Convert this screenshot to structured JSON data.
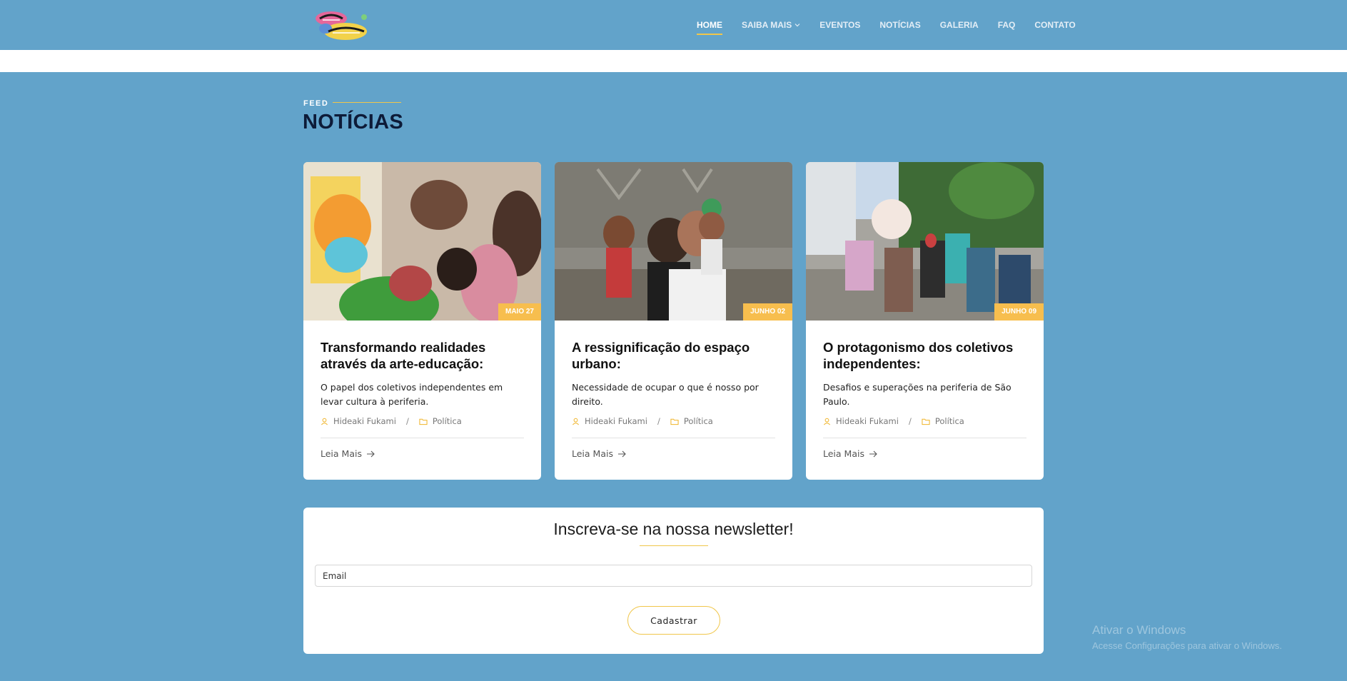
{
  "header": {
    "logo_alt": "Amigos do Bairro",
    "nav": [
      {
        "label": "HOME",
        "active": true
      },
      {
        "label": "SAIBA MAIS",
        "has_dropdown": true
      },
      {
        "label": "EVENTOS"
      },
      {
        "label": "NOTÍCIAS"
      },
      {
        "label": "GALERIA"
      },
      {
        "label": "FAQ"
      },
      {
        "label": "CONTATO"
      }
    ]
  },
  "section": {
    "eyebrow": "FEED",
    "title": "NOTÍCIAS"
  },
  "cards": [
    {
      "date": "MAIO 27",
      "title": "Transformando realidades através da arte-educação:",
      "description": "O papel dos coletivos independentes em levar cultura à periferia.",
      "author": "Hideaki Fukami",
      "category": "Política",
      "read_more": "Leia Mais"
    },
    {
      "date": "JUNHO 02",
      "title": "A ressignificação do espaço urbano:",
      "description": "Necessidade de ocupar o que é nosso por direito.",
      "author": "Hideaki Fukami",
      "category": "Política",
      "read_more": "Leia Mais"
    },
    {
      "date": "JUNHO 09",
      "title": "O protagonismo dos coletivos independentes:",
      "description": "Desafios e superações na periferia de São Paulo.",
      "author": "Hideaki Fukami",
      "category": "Política",
      "read_more": "Leia Mais"
    }
  ],
  "newsletter": {
    "title": "Inscreva-se na nossa newsletter!",
    "email_placeholder": "Email",
    "button_label": "Cadastrar"
  },
  "watermark": {
    "title": "Ativar o Windows",
    "subtitle": "Acesse Configurações para ativar o Windows."
  },
  "colors": {
    "background": "#62a3ca",
    "accent": "#f0c64a",
    "badge": "#f7be4e",
    "title_dark": "#0d1b38"
  },
  "icons": [
    "user-icon",
    "folder-icon",
    "arrow-right-icon",
    "chevron-down-icon"
  ]
}
